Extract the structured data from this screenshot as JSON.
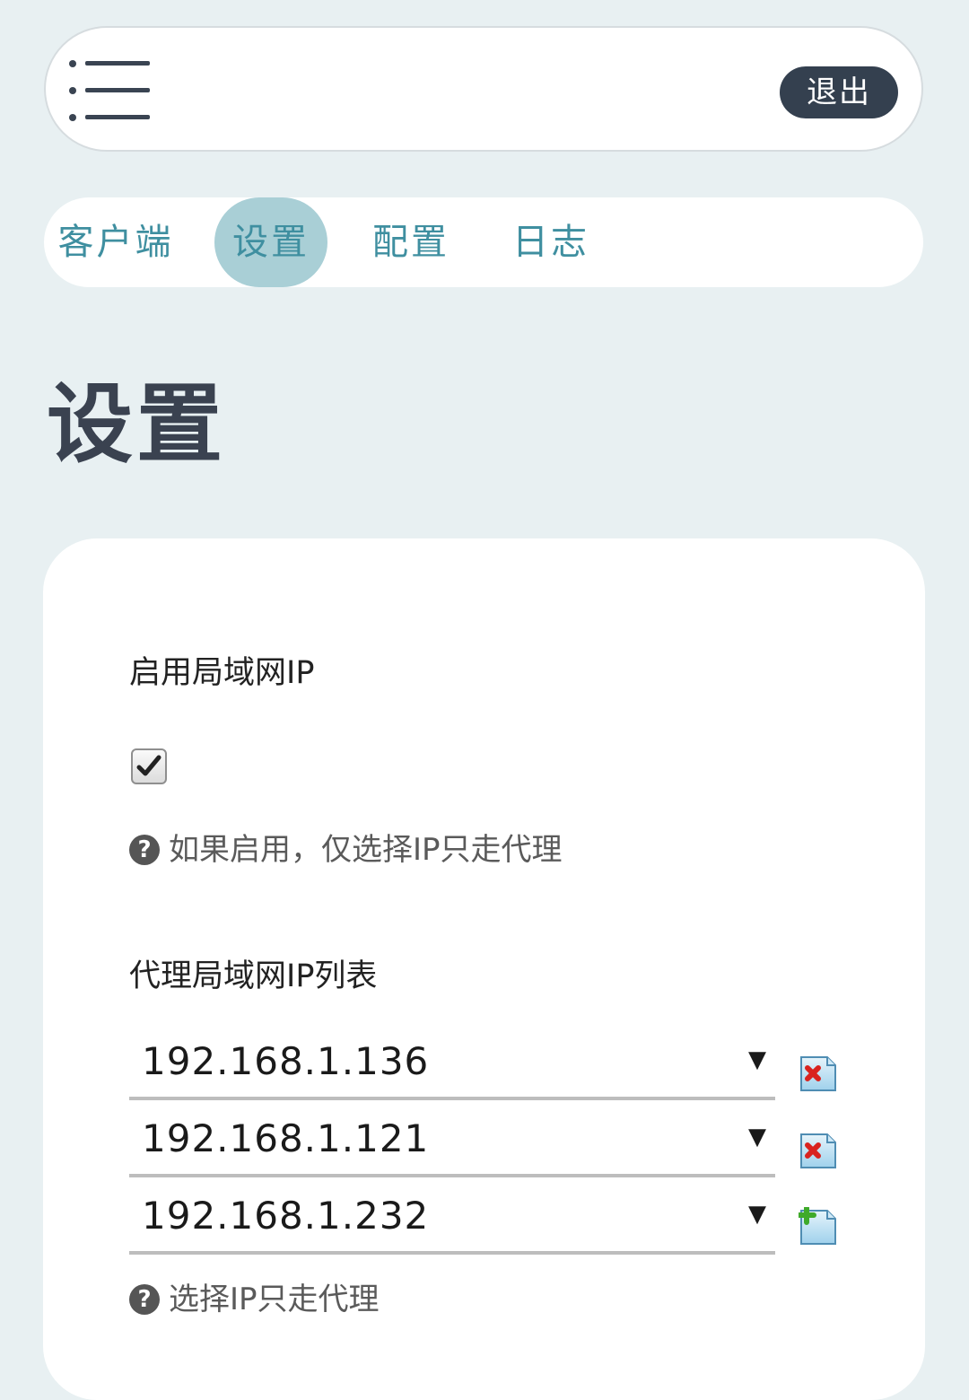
{
  "header": {
    "menu_icon": "menu-icon",
    "logout_label": "退出"
  },
  "tabs": [
    {
      "label": "客户端",
      "active": false
    },
    {
      "label": "设置",
      "active": true
    },
    {
      "label": "配置",
      "active": false
    },
    {
      "label": "日志",
      "active": false
    }
  ],
  "page": {
    "title": "设置"
  },
  "settings": {
    "enable_lan_ip": {
      "label": "启用局域网IP",
      "checked": true,
      "hint": "如果启用，仅选择IP只走代理"
    },
    "proxy_ip_list": {
      "label": "代理局域网IP列表",
      "items": [
        {
          "value": "192.168.1.136",
          "action": "remove",
          "action_icon": "remove-icon"
        },
        {
          "value": "192.168.1.121",
          "action": "remove",
          "action_icon": "remove-icon"
        },
        {
          "value": "192.168.1.232",
          "action": "add",
          "action_icon": "add-icon"
        }
      ],
      "dropdown_glyph": "▼",
      "hint": "选择IP只走代理"
    }
  },
  "colors": {
    "page_bg": "#e8f0f2",
    "tab_text": "#3f8fa0",
    "tab_active_bg": "#a9cfd6",
    "logout_bg": "#34404f",
    "title_text": "#3a4250"
  }
}
